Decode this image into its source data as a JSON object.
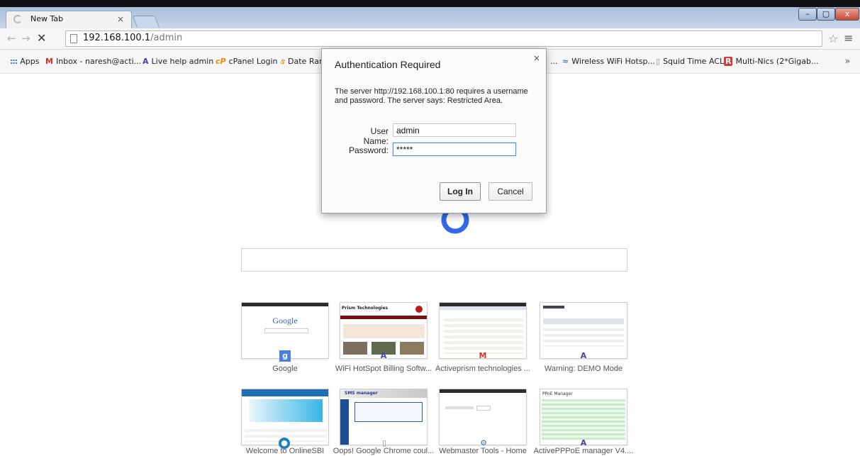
{
  "browser": {
    "tab_title": "New Tab",
    "tab_close": "×",
    "window_controls": {
      "minimize": "–",
      "maximize": "▢",
      "close": "x"
    },
    "nav": {
      "back": "←",
      "forward": "→",
      "stop": "✕"
    },
    "url_host": "192.168.100.1",
    "url_path": "/admin",
    "star_icon": "☆",
    "menu_icon": "≡"
  },
  "bookmarks": [
    {
      "icon": "apps-icon",
      "glyph": ":::",
      "label": "Apps"
    },
    {
      "icon": "gmail-icon",
      "glyph": "M",
      "label": "Inbox - naresh@acti..."
    },
    {
      "icon": "activeprism-icon",
      "glyph": "A",
      "label": "Live help admin"
    },
    {
      "icon": "cpanel-icon",
      "glyph": "cP",
      "label": "cPanel Login"
    },
    {
      "icon": "date-icon",
      "glyph": "ઙ",
      "label": "Date Rar"
    },
    {
      "icon": "wifi-icon",
      "glyph": "≈",
      "label": "Wireless WiFi Hotsp..."
    },
    {
      "icon": "doc-icon",
      "glyph": "▯",
      "label": "Squid Time ACL's"
    },
    {
      "icon": "multinics-icon",
      "glyph": "R",
      "label": "Multi-Nics (2*Gigab..."
    }
  ],
  "bookmarks_overflow_dots": "...",
  "bookmarks_more": "»",
  "dialog": {
    "title": "Authentication Required",
    "close": "×",
    "message": "The server http://192.168.100.1:80 requires a username and password. The server says: Restricted Area.",
    "username_label": "User Name:",
    "username_value": "admin",
    "password_label": "Password:",
    "password_value": "*****",
    "login_label": "Log In",
    "cancel_label": "Cancel"
  },
  "most_visited": [
    {
      "label": "Google",
      "badge_icon": "google-g-icon",
      "badge": "g"
    },
    {
      "label": "WiFi HotSpot Billing Softw...",
      "badge_icon": "activeprism-icon",
      "badge": "A"
    },
    {
      "label": "Activeprism technologies ...",
      "badge_icon": "gmail-icon",
      "badge": "M"
    },
    {
      "label": "Warning: DEMO Mode",
      "badge_icon": "activeprism-icon",
      "badge": "A"
    },
    {
      "label": "Welcome to OnlineSBI",
      "badge_icon": "sbi-icon",
      "badge": "●"
    },
    {
      "label": "Oops! Google Chrome coul...",
      "badge_icon": "doc-icon",
      "badge": "▯"
    },
    {
      "label": "Webmaster Tools - Home",
      "badge_icon": "webmaster-icon",
      "badge": "⚙"
    },
    {
      "label": "ActivePPPoE manager V4....",
      "badge_icon": "activeprism-icon",
      "badge": "A"
    }
  ],
  "thumb_text": {
    "google_logo": "Google",
    "prism_title": "Prism Technologies",
    "sms_title": "SMS manager",
    "pppoe_title": "PPoE Manager"
  }
}
